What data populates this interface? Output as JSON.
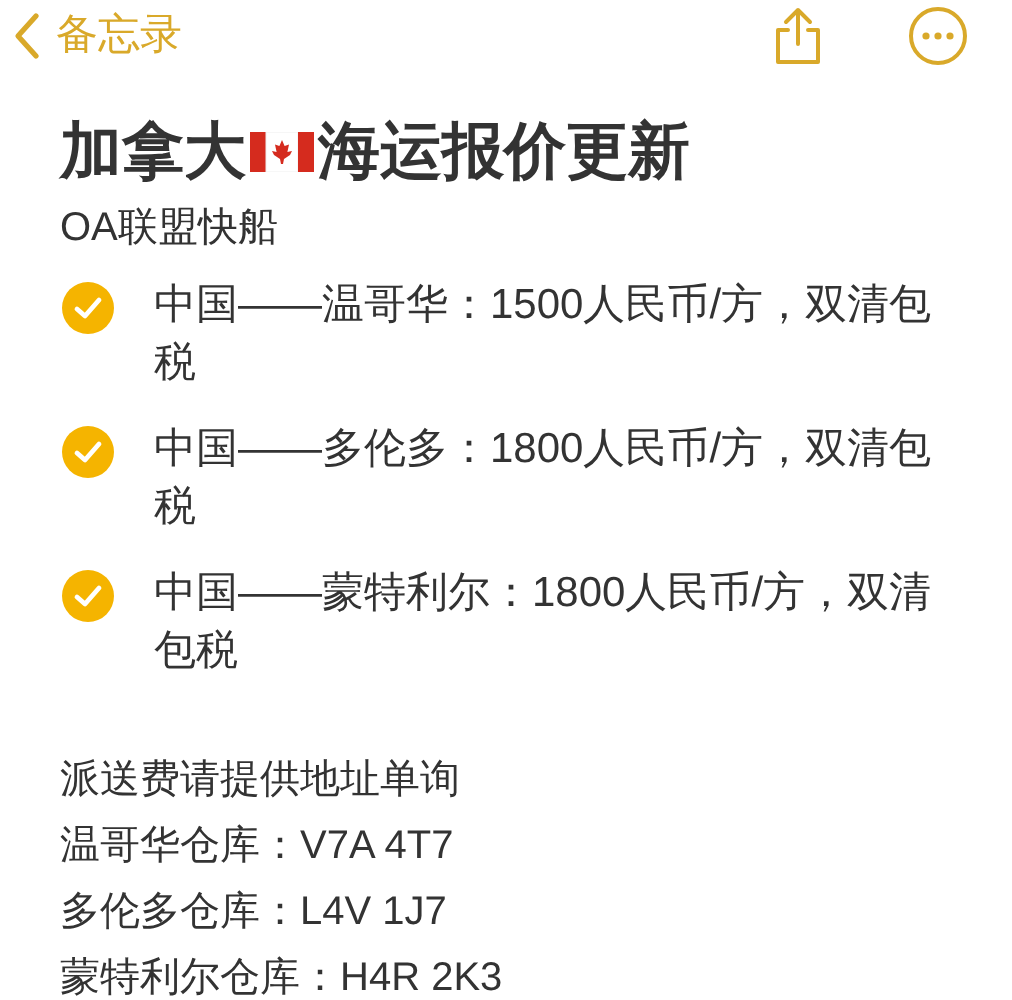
{
  "nav": {
    "back_label": "备忘录"
  },
  "title": {
    "before_flag": "加拿大",
    "after_flag": "海运报价更新"
  },
  "subtitle": "OA联盟快船",
  "checklist": [
    {
      "text": "中国——温哥华：1500人民币/方，双清包税",
      "checked": true
    },
    {
      "text": "中国——多伦多：1800人民币/方，双清包税",
      "checked": true
    },
    {
      "text": "中国——蒙特利尔：1800人民币/方，双清包税",
      "checked": true
    }
  ],
  "lines": [
    "派送费请提供地址单询",
    "温哥华仓库：V7A 4T7",
    "多伦多仓库：L4V 1J7",
    "蒙特利尔仓库：H4R 2K3"
  ]
}
